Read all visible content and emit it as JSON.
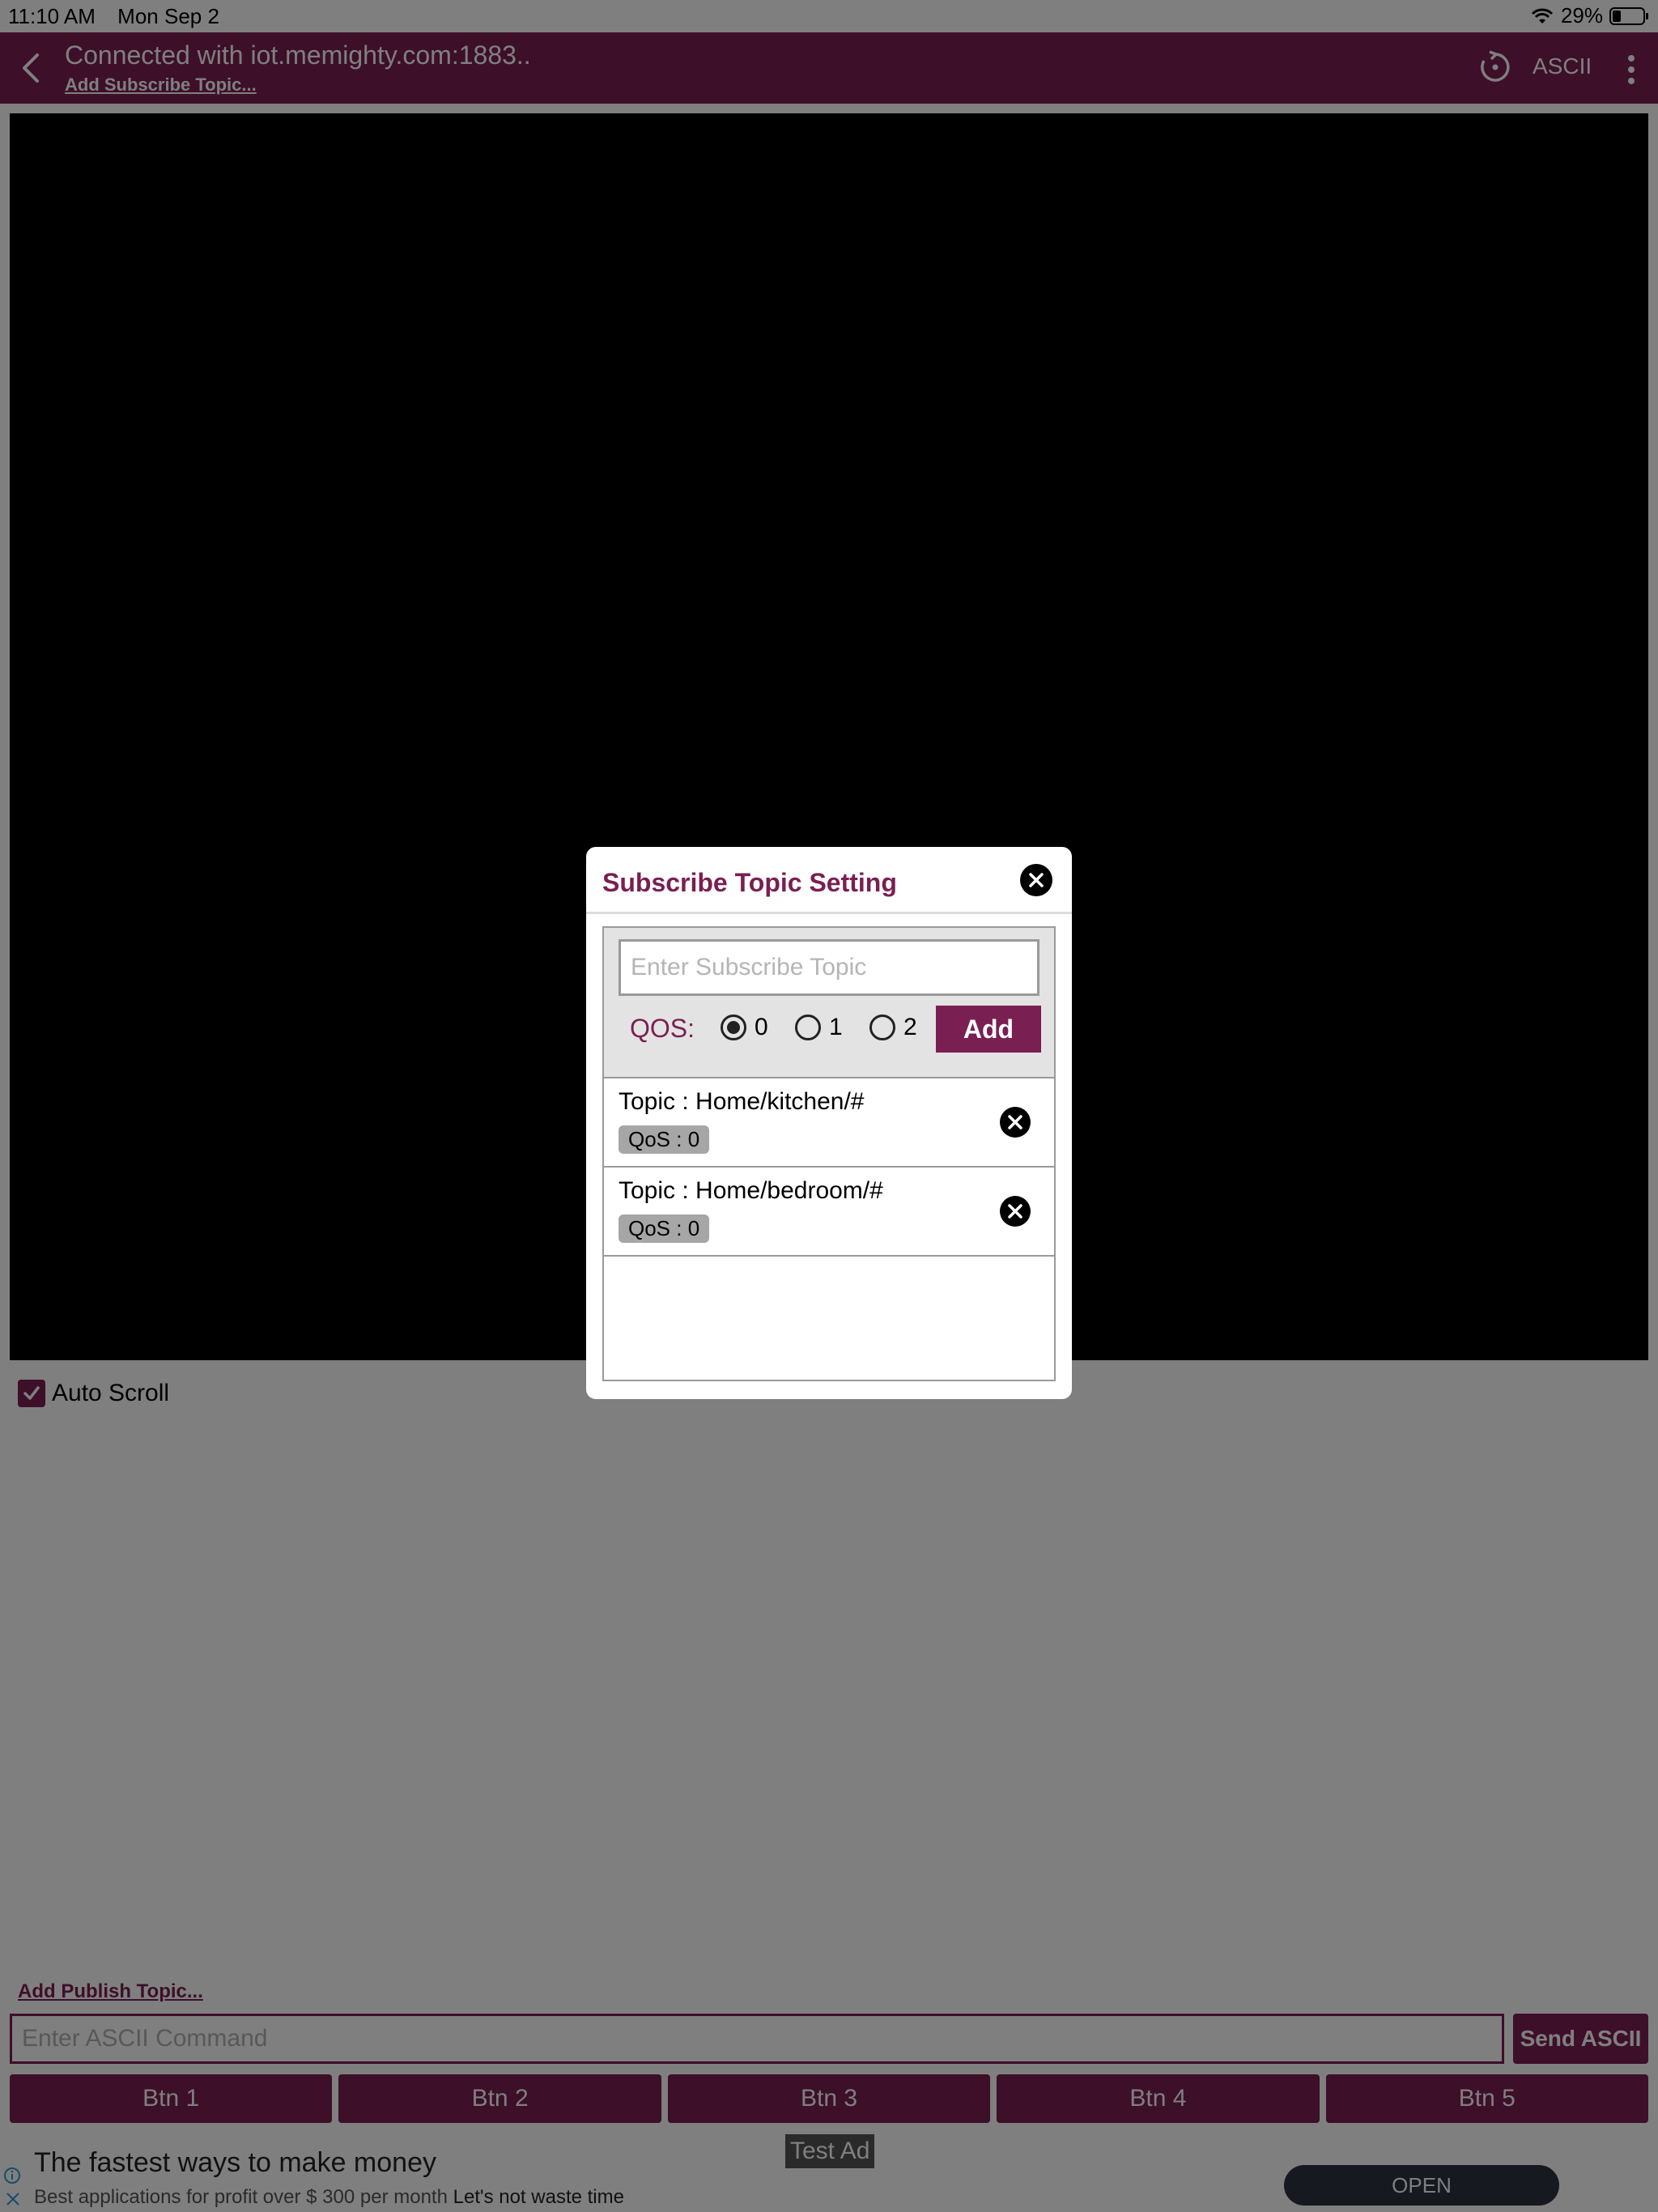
{
  "status_bar": {
    "time": "11:10 AM",
    "date": "Mon Sep 2",
    "battery": "29%"
  },
  "header": {
    "title": "Connected with iot.memighty.com:1883..",
    "subscribe_link": "Add Subscribe Topic...",
    "mode": "ASCII"
  },
  "controls": {
    "auto_scroll_label": "Auto Scroll",
    "auto_scroll_checked": true,
    "publish_link": "Add Publish Topic...",
    "command_placeholder": "Enter ASCII Command",
    "send_label": "Send ASCII",
    "buttons": [
      "Btn 1",
      "Btn 2",
      "Btn 3",
      "Btn 4",
      "Btn 5"
    ]
  },
  "ad": {
    "title": "The fastest ways to make money",
    "description": "Best applications for profit over $ 300 per month",
    "description_tail": "Let's not waste time",
    "badge": "Test Ad",
    "cta": "OPEN"
  },
  "modal": {
    "title": "Subscribe Topic Setting",
    "input_placeholder": "Enter Subscribe Topic",
    "qos_label": "QOS:",
    "qos_options": [
      "0",
      "1",
      "2"
    ],
    "qos_selected": "0",
    "add_label": "Add",
    "topics": [
      {
        "topic": "Topic : Home/kitchen/#",
        "qos": "QoS : 0"
      },
      {
        "topic": "Topic : Home/bedroom/#",
        "qos": "QoS : 0"
      }
    ]
  },
  "colors": {
    "brand": "#7a1f52",
    "ad_button": "#2c3240"
  }
}
